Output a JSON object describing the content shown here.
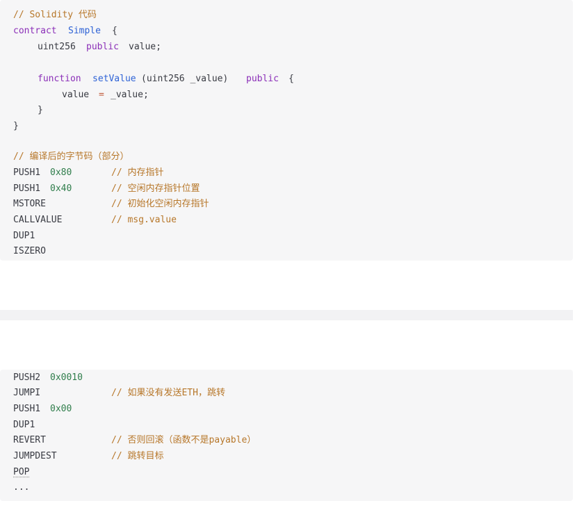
{
  "source": {
    "comment": "// Solidity 代码",
    "contract_kw": "contract",
    "contract_name": "Simple",
    "brace_open": "{",
    "var_type": "uint256",
    "var_public": "public",
    "var_decl": "value;",
    "func_kw": "function",
    "func_name": "setValue",
    "func_params": "(uint256 _value)",
    "func_public": "public",
    "func_brace": "{",
    "assign_lhs": "value",
    "assign_op": "=",
    "assign_rhs": "_value;",
    "inner_close": "}",
    "outer_close": "}"
  },
  "bytecode": {
    "comment": "// 编译后的字节码（部分）",
    "rows": [
      {
        "op": "PUSH1",
        "arg": "0x80",
        "comment": "// 内存指针"
      },
      {
        "op": "PUSH1",
        "arg": "0x40",
        "comment": "// 空闲内存指针位置"
      },
      {
        "op": "MSTORE",
        "arg": "",
        "comment": "// 初始化空闲内存指针"
      },
      {
        "op": "CALLVALUE",
        "arg": "",
        "comment": "// msg.value"
      },
      {
        "op": "DUP1",
        "arg": "",
        "comment": ""
      },
      {
        "op": "ISZERO",
        "arg": "",
        "comment": ""
      }
    ],
    "rows2": [
      {
        "op": "PUSH2",
        "arg": "0x0010",
        "comment": ""
      },
      {
        "op": "JUMPI",
        "arg": "",
        "comment": "// 如果没有发送ETH，跳转"
      },
      {
        "op": "PUSH1",
        "arg": "0x00",
        "comment": ""
      },
      {
        "op": "DUP1",
        "arg": "",
        "comment": ""
      },
      {
        "op": "REVERT",
        "arg": "",
        "comment": "// 否则回滚（函数不是payable）"
      },
      {
        "op": "JUMPDEST",
        "arg": "",
        "comment": "// 跳转目标"
      },
      {
        "op": "POP",
        "arg": "",
        "comment": ""
      },
      {
        "op": "...",
        "arg": "",
        "comment": ""
      }
    ]
  }
}
